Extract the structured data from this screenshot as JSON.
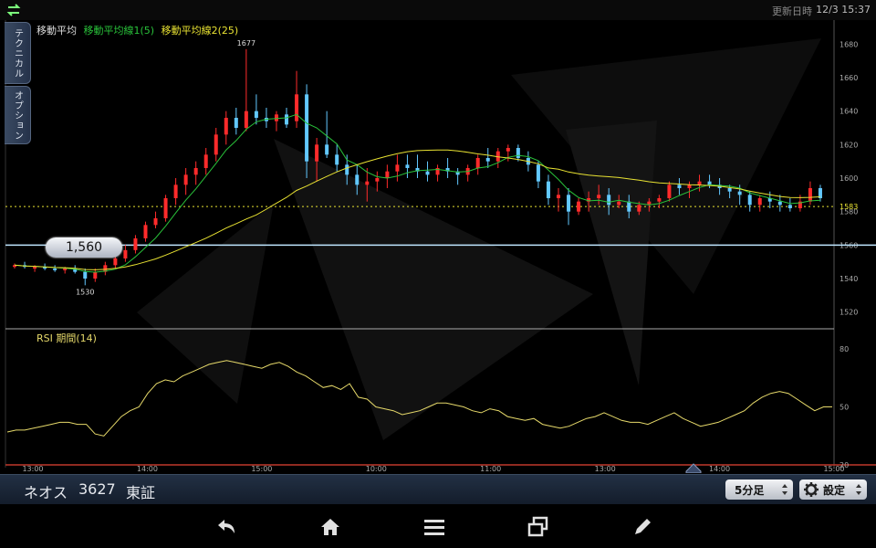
{
  "status_bar": {
    "updated_label": "更新日時",
    "updated_time": "12/3 15:37"
  },
  "side_tabs": {
    "technical": "テクニカル",
    "option": "オプション"
  },
  "legend": {
    "prefix": "移動平均",
    "ma1": "移動平均線1(5)",
    "ma2": "移動平均線2(25)",
    "rsi": "RSI 期間(14)"
  },
  "colors": {
    "up": "#ff2b2b",
    "down": "#62c8ff",
    "ma1": "#29c23a",
    "ma2": "#e8e232",
    "rsi": "#e6d96a",
    "current_line": "#bfe6ff",
    "dotted": "#e8e232"
  },
  "price_bubble": "1,560",
  "chart_data": {
    "type": "candlestick",
    "price_axis": {
      "ticks": [
        "1680",
        "1660",
        "1640",
        "1620",
        "1600",
        "1580",
        "1560",
        "1540",
        "1520"
      ],
      "min": 1510,
      "max": 1690
    },
    "rsi_axis": {
      "ticks": [
        "80",
        "50",
        "20"
      ],
      "min": 20,
      "max": 80
    },
    "x_ticks": [
      "13:00",
      "14:00",
      "15:00",
      "10:00",
      "11:00",
      "13:00",
      "14:00",
      "15:00"
    ],
    "annotations": {
      "high": "1677",
      "low": "1530",
      "reference": "1583",
      "current": "1560"
    },
    "ohlc": [
      [
        1547,
        1549,
        1546,
        1548
      ],
      [
        1548,
        1550,
        1546,
        1547
      ],
      [
        1546,
        1548,
        1544,
        1547
      ],
      [
        1547,
        1549,
        1545,
        1546
      ],
      [
        1546,
        1548,
        1544,
        1545
      ],
      [
        1545,
        1547,
        1543,
        1546
      ],
      [
        1546,
        1548,
        1543,
        1544
      ],
      [
        1544,
        1546,
        1536,
        1540
      ],
      [
        1540,
        1546,
        1538,
        1544
      ],
      [
        1544,
        1550,
        1542,
        1548
      ],
      [
        1548,
        1556,
        1546,
        1552
      ],
      [
        1552,
        1560,
        1550,
        1557
      ],
      [
        1557,
        1566,
        1555,
        1564
      ],
      [
        1564,
        1574,
        1562,
        1572
      ],
      [
        1572,
        1580,
        1570,
        1576
      ],
      [
        1576,
        1590,
        1574,
        1588
      ],
      [
        1588,
        1600,
        1584,
        1596
      ],
      [
        1596,
        1606,
        1590,
        1602
      ],
      [
        1602,
        1610,
        1596,
        1606
      ],
      [
        1606,
        1618,
        1602,
        1614
      ],
      [
        1614,
        1630,
        1610,
        1626
      ],
      [
        1626,
        1640,
        1620,
        1636
      ],
      [
        1636,
        1642,
        1626,
        1630
      ],
      [
        1630,
        1677,
        1628,
        1640
      ],
      [
        1640,
        1650,
        1632,
        1636
      ],
      [
        1636,
        1642,
        1630,
        1634
      ],
      [
        1634,
        1640,
        1628,
        1638
      ],
      [
        1638,
        1642,
        1630,
        1632
      ],
      [
        1634,
        1664,
        1630,
        1650
      ],
      [
        1650,
        1656,
        1600,
        1610
      ],
      [
        1610,
        1624,
        1598,
        1620
      ],
      [
        1620,
        1640,
        1612,
        1614
      ],
      [
        1614,
        1620,
        1604,
        1608
      ],
      [
        1608,
        1614,
        1596,
        1602
      ],
      [
        1602,
        1608,
        1590,
        1596
      ],
      [
        1596,
        1606,
        1586,
        1598
      ],
      [
        1598,
        1604,
        1592,
        1600
      ],
      [
        1600,
        1608,
        1594,
        1604
      ],
      [
        1604,
        1614,
        1598,
        1608
      ],
      [
        1608,
        1614,
        1600,
        1606
      ],
      [
        1606,
        1614,
        1600,
        1604
      ],
      [
        1604,
        1610,
        1598,
        1602
      ],
      [
        1602,
        1608,
        1598,
        1606
      ],
      [
        1606,
        1612,
        1600,
        1604
      ],
      [
        1604,
        1606,
        1596,
        1602
      ],
      [
        1602,
        1608,
        1598,
        1606
      ],
      [
        1606,
        1614,
        1602,
        1612
      ],
      [
        1612,
        1618,
        1606,
        1610
      ],
      [
        1610,
        1618,
        1606,
        1616
      ],
      [
        1616,
        1620,
        1610,
        1618
      ],
      [
        1618,
        1620,
        1610,
        1612
      ],
      [
        1612,
        1616,
        1604,
        1608
      ],
      [
        1608,
        1610,
        1594,
        1598
      ],
      [
        1598,
        1602,
        1584,
        1588
      ],
      [
        1588,
        1594,
        1580,
        1590
      ],
      [
        1590,
        1594,
        1572,
        1580
      ],
      [
        1580,
        1588,
        1578,
        1586
      ],
      [
        1586,
        1592,
        1580,
        1588
      ],
      [
        1588,
        1596,
        1584,
        1590
      ],
      [
        1590,
        1594,
        1578,
        1584
      ],
      [
        1584,
        1590,
        1582,
        1586
      ],
      [
        1586,
        1590,
        1576,
        1580
      ],
      [
        1580,
        1586,
        1578,
        1584
      ],
      [
        1584,
        1588,
        1580,
        1586
      ],
      [
        1586,
        1590,
        1582,
        1588
      ],
      [
        1588,
        1598,
        1586,
        1596
      ],
      [
        1596,
        1600,
        1590,
        1594
      ],
      [
        1594,
        1598,
        1588,
        1596
      ],
      [
        1596,
        1602,
        1592,
        1598
      ],
      [
        1598,
        1602,
        1594,
        1596
      ],
      [
        1596,
        1600,
        1590,
        1594
      ],
      [
        1594,
        1596,
        1588,
        1592
      ],
      [
        1592,
        1596,
        1584,
        1590
      ],
      [
        1590,
        1592,
        1580,
        1584
      ],
      [
        1584,
        1590,
        1580,
        1588
      ],
      [
        1588,
        1592,
        1582,
        1586
      ],
      [
        1586,
        1590,
        1580,
        1584
      ],
      [
        1584,
        1588,
        1580,
        1582
      ],
      [
        1582,
        1590,
        1580,
        1586
      ],
      [
        1586,
        1598,
        1584,
        1594
      ],
      [
        1594,
        1596,
        1586,
        1588
      ]
    ],
    "rsi": [
      37,
      38,
      38,
      39,
      40,
      41,
      42,
      42,
      41,
      41,
      36,
      35,
      40,
      45,
      48,
      50,
      57,
      62,
      64,
      63,
      66,
      68,
      70,
      72,
      73,
      74,
      73,
      72,
      71,
      70,
      72,
      73,
      71,
      68,
      66,
      63,
      60,
      61,
      59,
      62,
      55,
      54,
      50,
      49,
      48,
      46,
      47,
      48,
      50,
      52,
      52,
      51,
      50,
      48,
      47,
      49,
      48,
      45,
      44,
      43,
      44,
      41,
      40,
      39,
      40,
      42,
      44,
      45,
      47,
      45,
      43,
      42,
      42,
      41,
      43,
      45,
      47,
      44,
      42,
      40,
      41,
      42,
      44,
      46,
      48,
      52,
      55,
      57,
      58,
      57,
      54,
      51,
      48,
      50,
      50
    ]
  },
  "toolbar": {
    "stock_name": "ネオス",
    "stock_code": "3627",
    "market": "東証",
    "interval": "5分足",
    "settings": "設定"
  },
  "nav": [
    "back-icon",
    "home-icon",
    "menu-icon",
    "windows-icon",
    "edit-icon"
  ]
}
